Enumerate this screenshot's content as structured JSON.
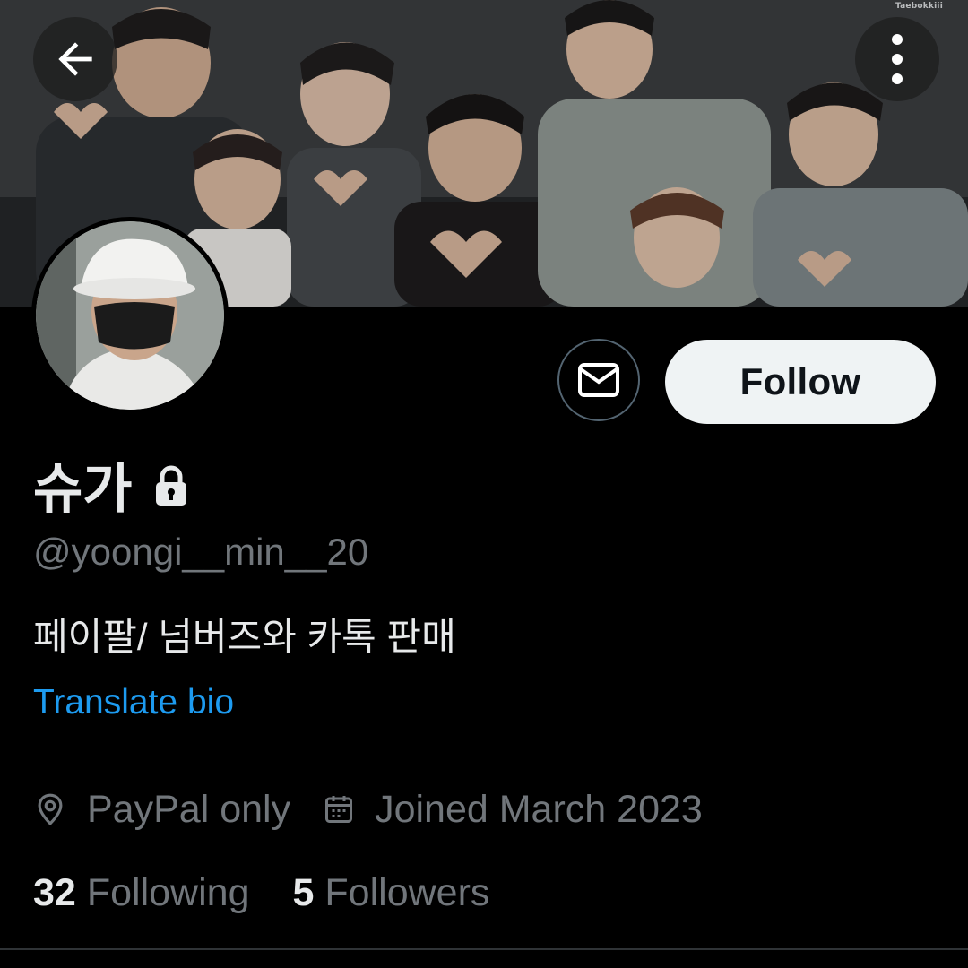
{
  "banner": {
    "watermark": "Taebokkiii"
  },
  "icons": {
    "back": "arrow-left-icon",
    "more": "more-vertical-icon",
    "message": "envelope-icon",
    "protected": "lock-icon",
    "location": "location-pin-icon",
    "joined": "calendar-icon"
  },
  "actions": {
    "follow_label": "Follow"
  },
  "profile": {
    "display_name": "슈가",
    "handle": "@yoongi__min__20",
    "bio": "페이팔/ 넘버즈와 카톡 판매",
    "translate_label": "Translate bio",
    "location": "PayPal only",
    "joined": "Joined March 2023"
  },
  "stats": {
    "following_count": "32",
    "following_label": "Following",
    "followers_count": "5",
    "followers_label": "Followers"
  },
  "colors": {
    "background": "#000000",
    "primary_text": "#e7e9ea",
    "secondary_text": "#71767b",
    "link": "#1d9bf0",
    "follow_button_bg": "#eff3f4"
  }
}
